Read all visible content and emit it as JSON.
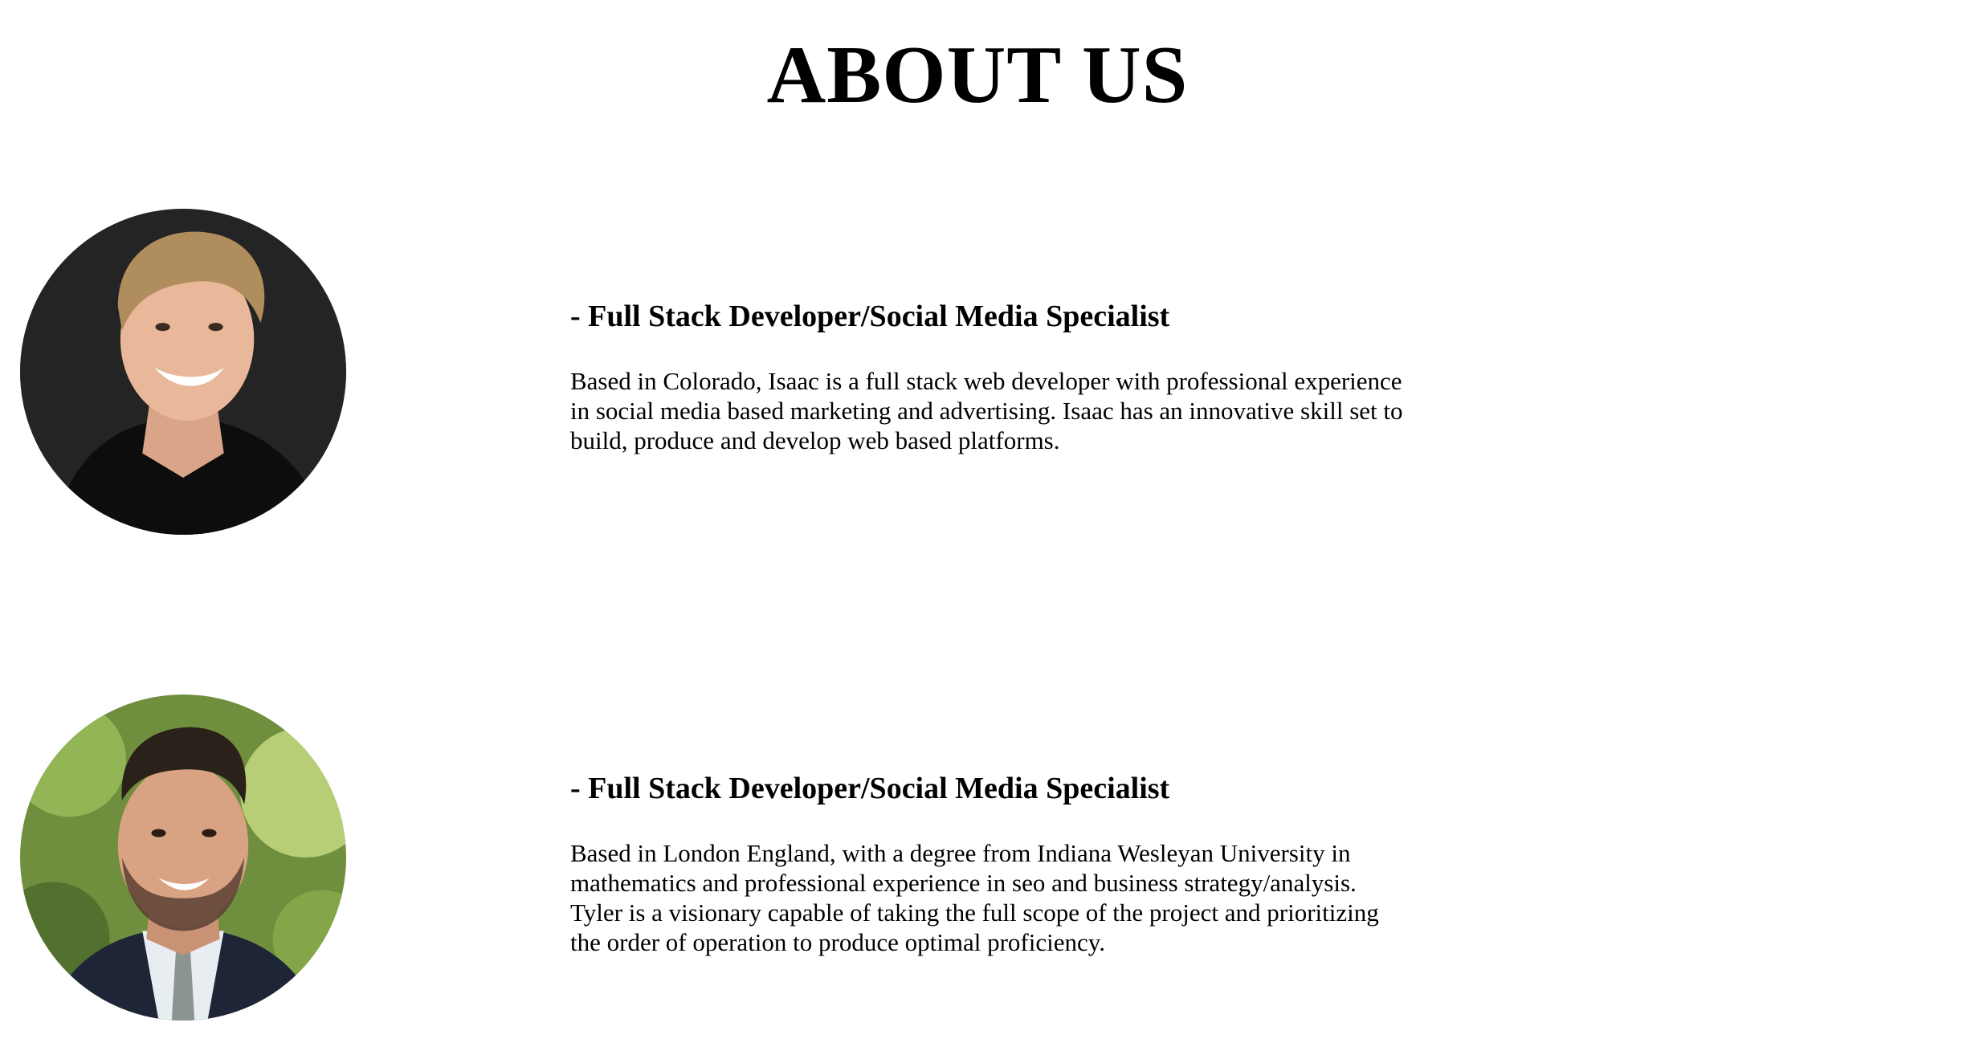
{
  "page": {
    "title": "ABOUT US"
  },
  "members": [
    {
      "role": "- Full Stack Developer/Social Media Specialist",
      "description": "Based in Colorado, Isaac is a full stack web developer with professional experience in social media based marketing and advertising. Isaac has an innovative skill set to build, produce and develop web based platforms."
    },
    {
      "role": "- Full Stack Developer/Social Media Specialist",
      "description": "Based in London England, with a degree from Indiana Wesleyan University in mathematics and professional experience in seo and business strategy/analysis. Tyler is a visionary capable of taking the full scope of the project and prioritizing the order of operation to produce optimal proficiency."
    }
  ]
}
